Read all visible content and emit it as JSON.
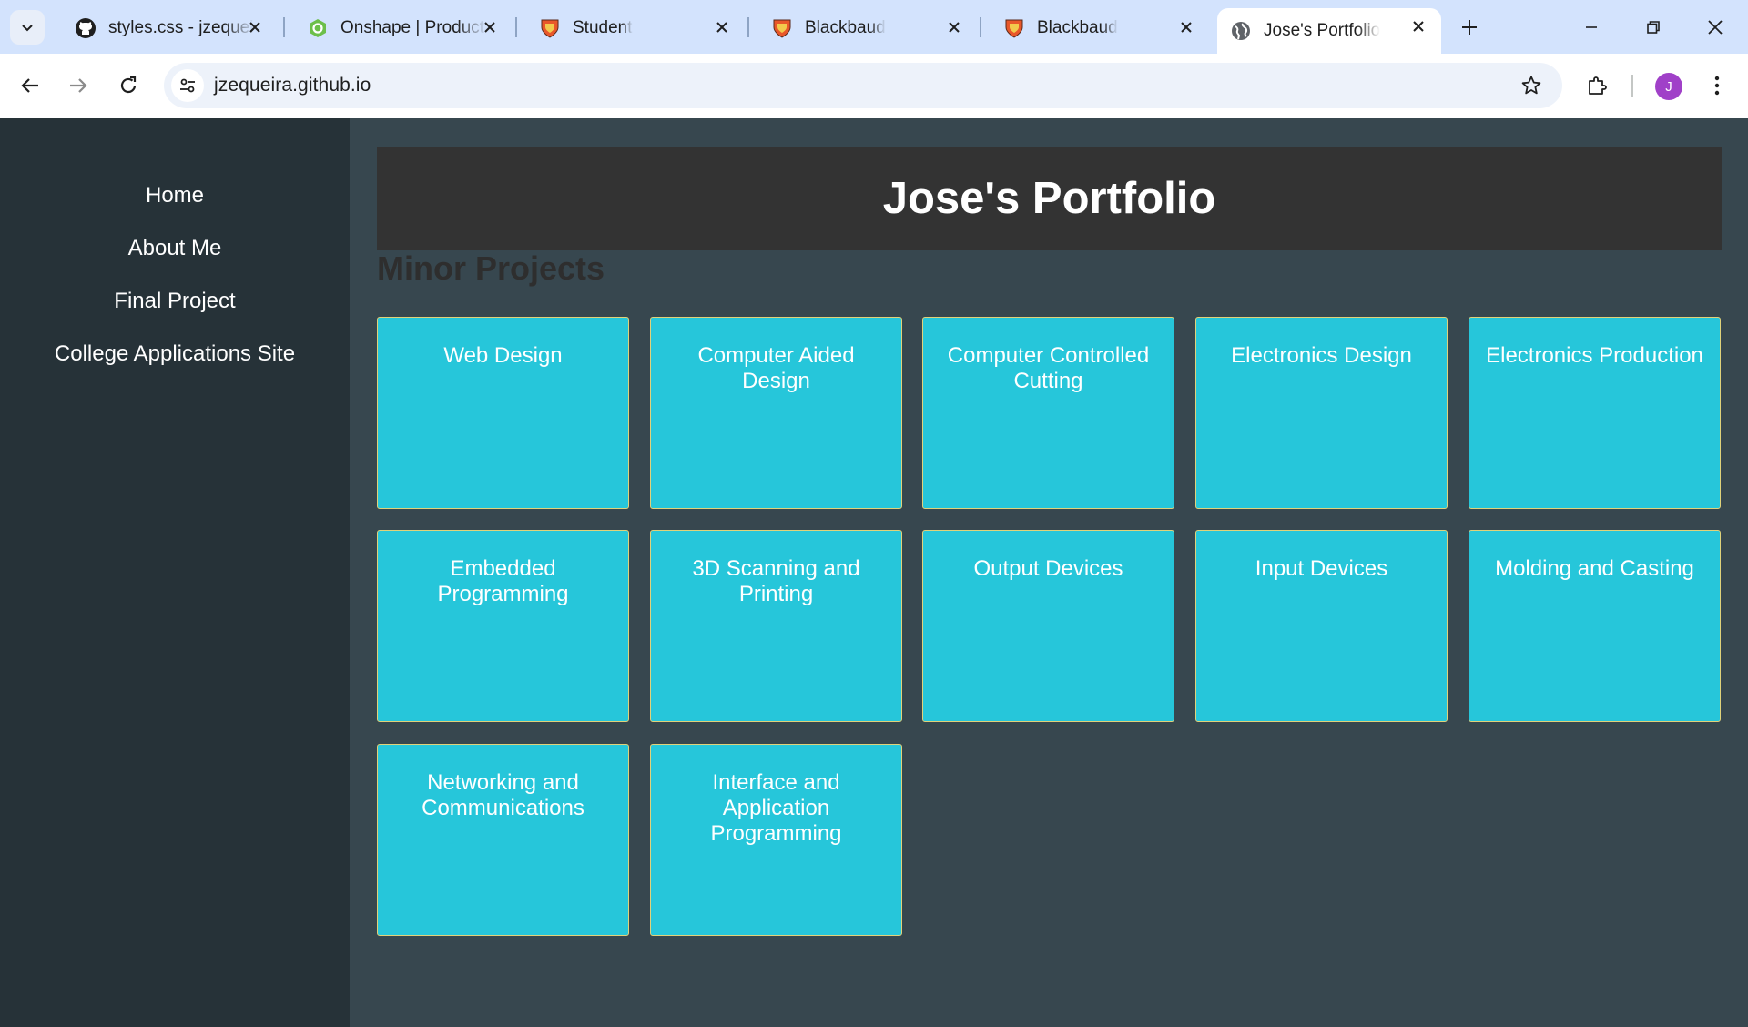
{
  "browser": {
    "tabs": [
      {
        "title": "styles.css - jzequeira",
        "icon": "github-icon"
      },
      {
        "title": "Onshape | Product",
        "icon": "onshape-icon"
      },
      {
        "title": "Student",
        "icon": "shield-icon"
      },
      {
        "title": "Blackbaud",
        "icon": "shield-icon"
      },
      {
        "title": "Blackbaud",
        "icon": "shield-icon"
      },
      {
        "title": "Jose's Portfolio",
        "icon": "globe-icon"
      }
    ],
    "active_tab_index": 5,
    "url": "jzequeira.github.io",
    "profile_initial": "J",
    "colors": {
      "tab_strip": "#d3e3fd",
      "omnibox": "#edf2fa",
      "avatar": "#a040c8"
    }
  },
  "sidebar": {
    "links": [
      {
        "label": "Home"
      },
      {
        "label": "About Me"
      },
      {
        "label": "Final Project"
      },
      {
        "label": "College Applications Site"
      }
    ]
  },
  "header": {
    "title": "Jose's Portfolio"
  },
  "section": {
    "title": "Minor Projects"
  },
  "projects": [
    {
      "label": "Web Design"
    },
    {
      "label": "Computer Aided Design"
    },
    {
      "label": "Computer Controlled Cutting"
    },
    {
      "label": "Electronics Design"
    },
    {
      "label": "Electronics Production"
    },
    {
      "label": "Embedded Programming"
    },
    {
      "label": "3D Scanning and Printing"
    },
    {
      "label": "Output Devices"
    },
    {
      "label": "Input Devices"
    },
    {
      "label": "Molding and Casting"
    },
    {
      "label": "Networking and Communications"
    },
    {
      "label": "Interface and Application Programming"
    }
  ],
  "colors": {
    "sidebar_bg": "#263238",
    "page_bg": "#37474f",
    "header_bg": "#333333",
    "card_bg": "#26c6da",
    "card_border": "#e0d27a"
  }
}
